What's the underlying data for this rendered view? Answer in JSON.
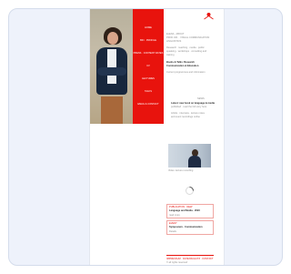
{
  "nav": {
    "items": [
      "HOME",
      "BIO · PROFILE",
      "PRESS · CONTENT DATES",
      "CV",
      "LECTURES",
      "TALKS",
      "EMAIL & CONTACT"
    ]
  },
  "intro": {
    "name": "ELENA · ABOUT",
    "sub1": "PROF. DR. · VISUAL COMMUNICATION",
    "sub2": "LINGUISTICS",
    "p1a": "Research · teaching · media · public",
    "p1b": "speaking · workshops · consulting and",
    "p1c": "training",
    "h1": "Books & Talks: Research",
    "h2": "Communication & Education",
    "p2": "Current programmes and information"
  },
  "section2": {
    "label": "NEWS",
    "l1": "Latest: new book on language & media",
    "l2": "published · read the full story here",
    "l3": "Article · interview · lecture notes",
    "l4": "and event recordings online"
  },
  "video_caption": "Video: lecture recording",
  "card1": {
    "l1": "PUBLICATION · NEW",
    "l2": "Language and Media · 2023",
    "l3": "read more"
  },
  "card2": {
    "l1": "EVENT",
    "l2": "Symposium · Communication",
    "l3": "Details"
  },
  "footer": {
    "f1": "IMPRESSUM · DATENSCHUTZ · KONTAKT",
    "f2": "© all rights reserved"
  },
  "colors": {
    "accent": "#e8130d"
  }
}
